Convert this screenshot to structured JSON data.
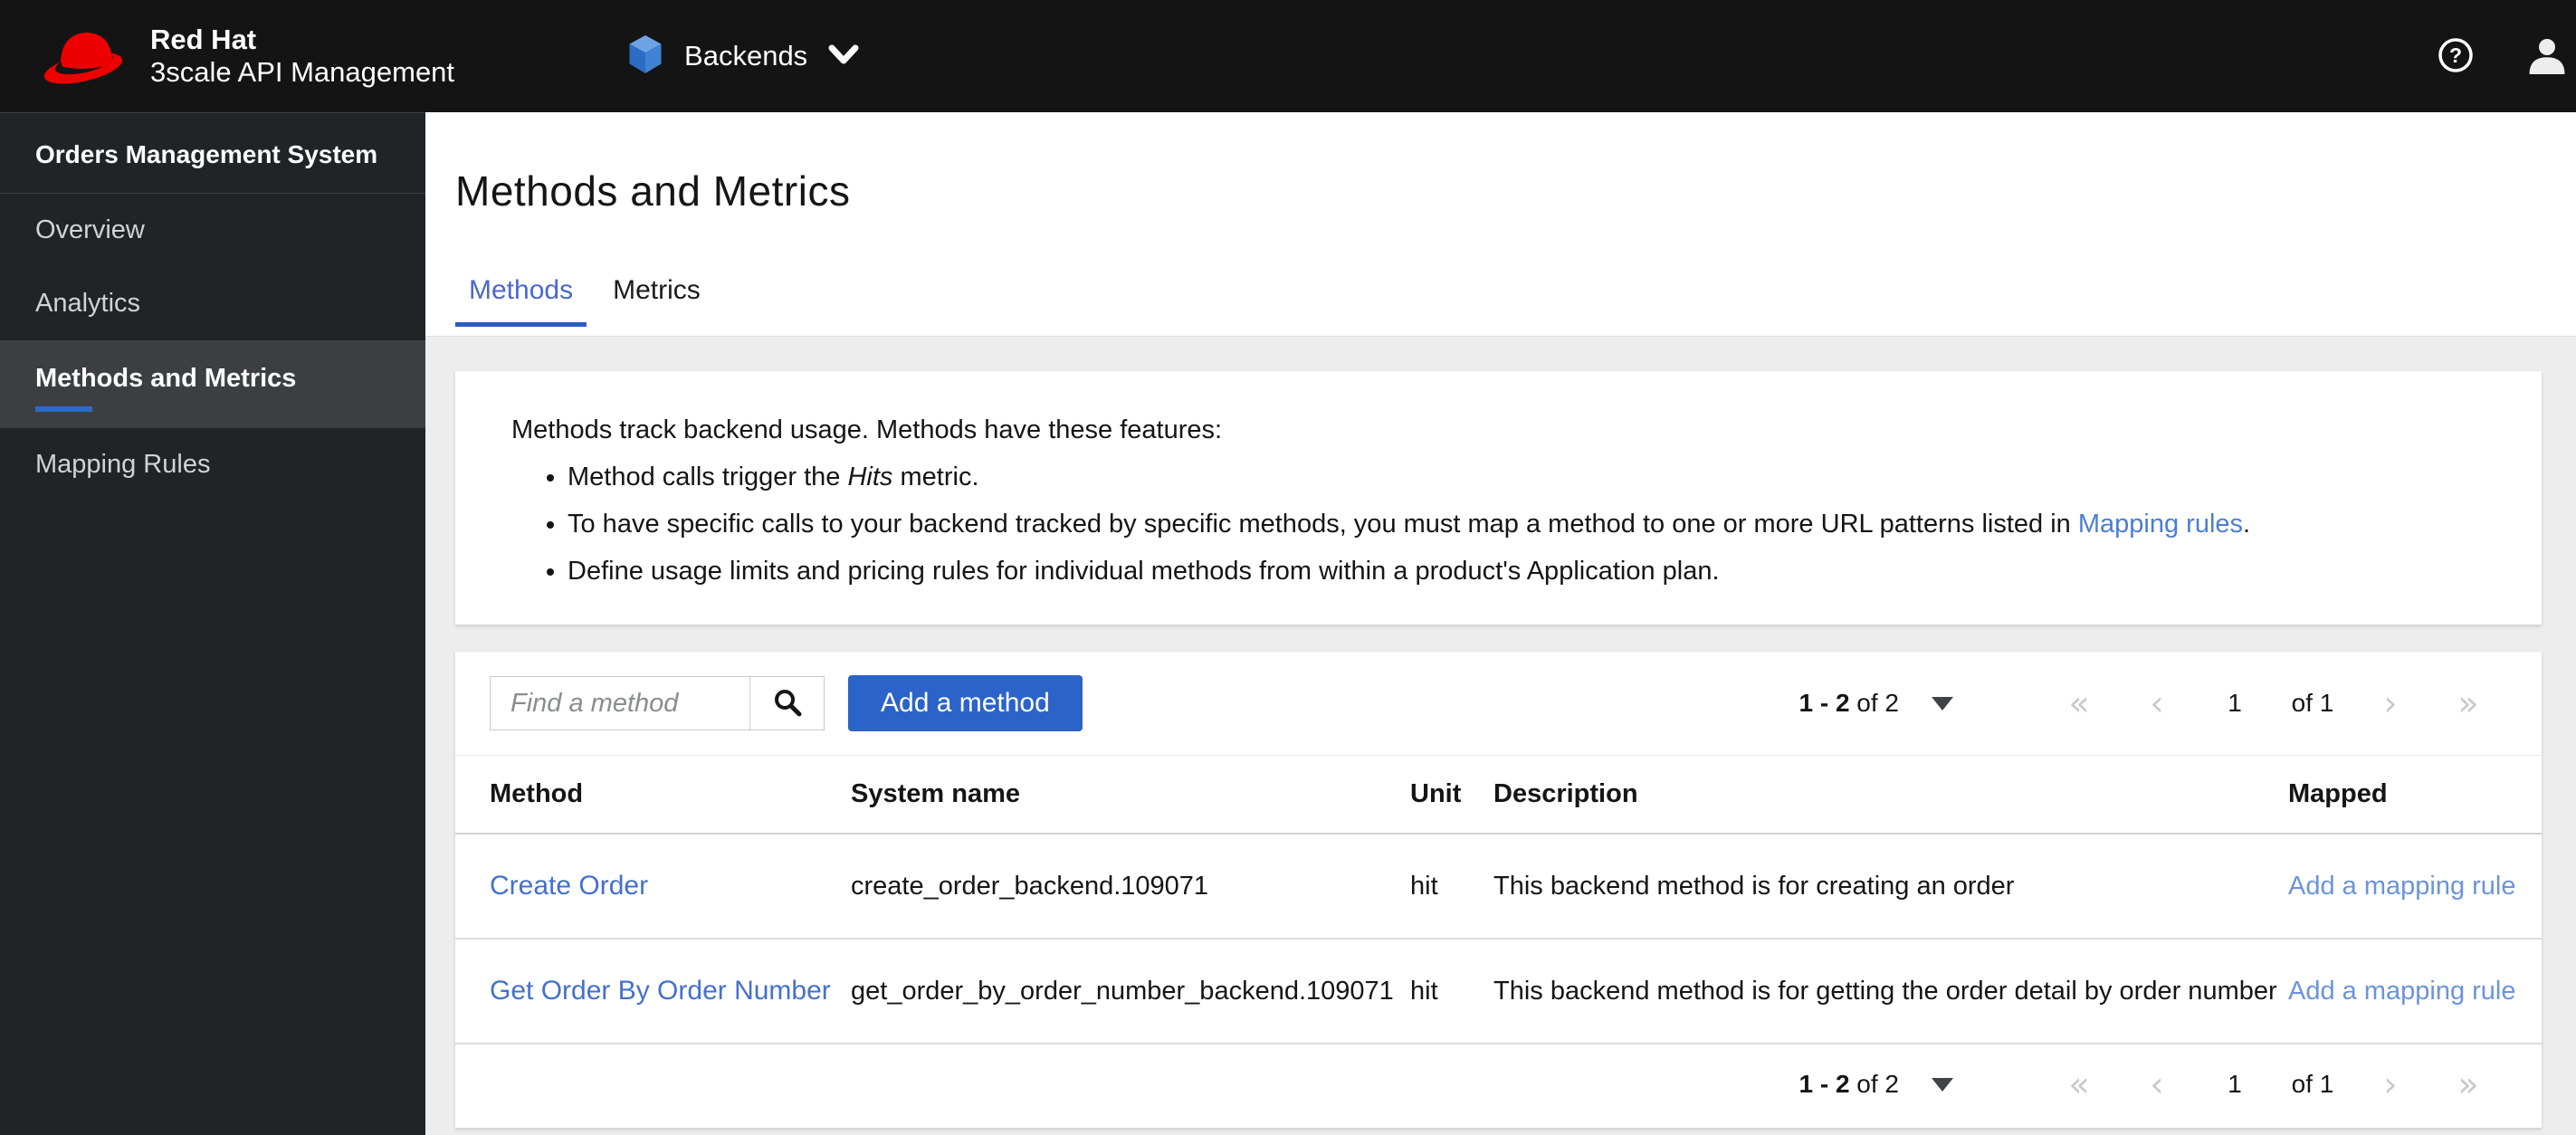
{
  "masthead": {
    "brand_line1": "Red Hat",
    "brand_line2": "3scale API Management",
    "context_selector_label": "Backends"
  },
  "sidebar": {
    "group_title": "Orders Management System",
    "items": [
      {
        "label": "Overview"
      },
      {
        "label": "Analytics"
      },
      {
        "label": "Methods and Metrics"
      },
      {
        "label": "Mapping Rules"
      }
    ]
  },
  "page": {
    "title": "Methods and Metrics",
    "tabs": [
      {
        "label": "Methods"
      },
      {
        "label": "Metrics"
      }
    ]
  },
  "info_card": {
    "intro": "Methods track backend usage. Methods have these features:",
    "bullet1_pre": "Method calls trigger the ",
    "bullet1_em": "Hits",
    "bullet1_post": " metric.",
    "bullet2_pre": "To have specific calls to your backend tracked by specific methods, you must map a method to one or more URL patterns listed in ",
    "bullet2_link": "Mapping rules",
    "bullet2_post": ".",
    "bullet3": "Define usage limits and pricing rules for individual methods from within a product's Application plan."
  },
  "table_card": {
    "search_placeholder": "Find a method",
    "add_button_label": "Add a method",
    "pagination": {
      "range_bold": "1 - 2",
      "range_rest": "of 2",
      "page_current": "1",
      "page_total": "of 1",
      "first_icon": "«",
      "prev_icon": "‹",
      "next_icon": "›",
      "last_icon": "»"
    },
    "table": {
      "headers": [
        "Method",
        "System name",
        "Unit",
        "Description",
        "Mapped"
      ],
      "rows": [
        {
          "method": "Create Order",
          "system_name": "create_order_backend.109071",
          "unit": "hit",
          "description": "This backend method is for creating an order",
          "mapped": "Add a mapping rule"
        },
        {
          "method": "Get Order By Order Number",
          "system_name": "get_order_by_order_number_backend.109071",
          "unit": "hit",
          "description": "This backend method is for getting the order detail by order number",
          "mapped": "Add a mapping rule"
        }
      ]
    }
  },
  "colors": {
    "masthead_bg": "#141414",
    "sidebar_bg": "#212427",
    "sidebar_active_bg": "#3c3f42",
    "accent_blue": "#2b63c9",
    "tab_active_blue": "#4a68cc",
    "method_link_blue": "#4470cc",
    "mapped_link_blue": "#6b94d9",
    "page_bg": "#ededed"
  }
}
